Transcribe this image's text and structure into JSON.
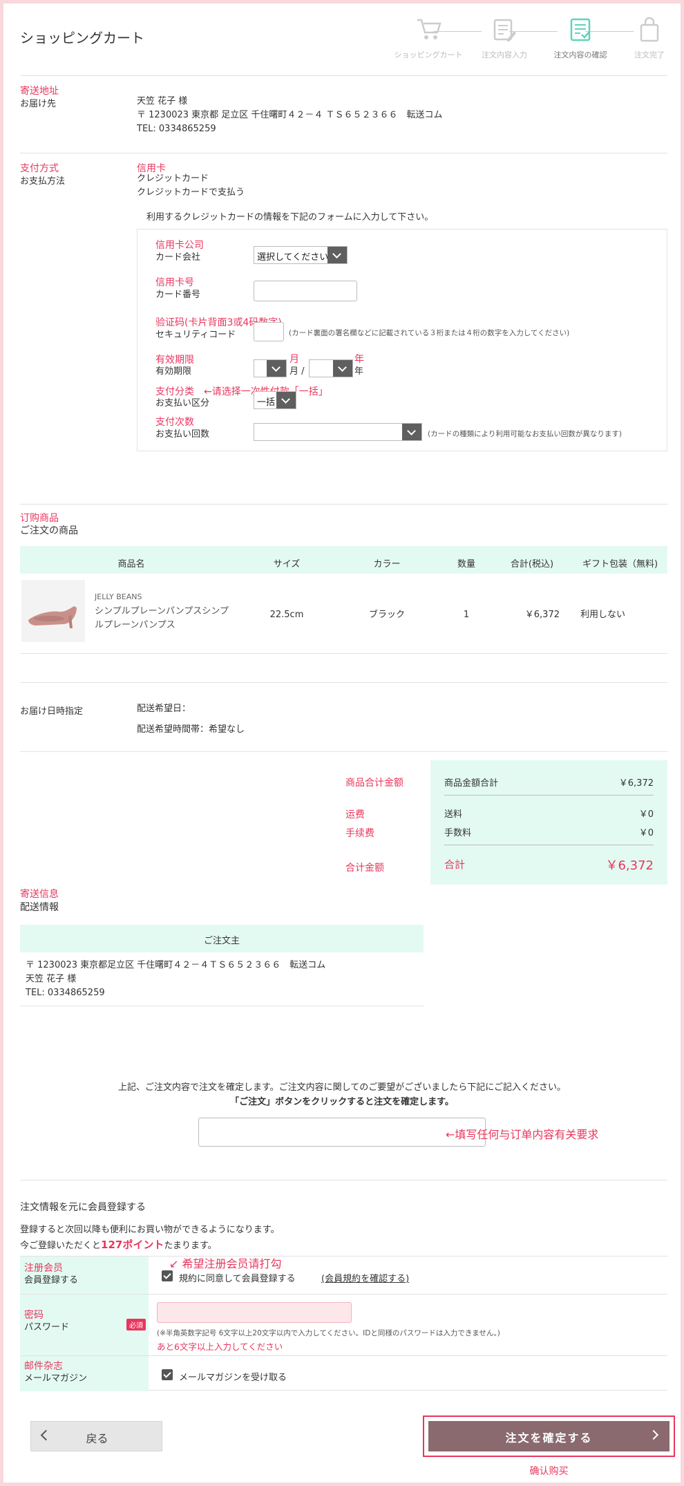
{
  "header": {
    "title": "ショッピングカート",
    "steps": [
      {
        "label": "ショッピングカート",
        "icon": "cart-icon"
      },
      {
        "label": "注文内容入力",
        "icon": "edit-form-icon"
      },
      {
        "label": "注文内容の確認",
        "icon": "checklist-icon"
      },
      {
        "label": "注文完了",
        "icon": "shopping-bag-icon"
      }
    ]
  },
  "shipping": {
    "zh": "寄送地址",
    "label": "お届け先",
    "name": "天笠 花子 様",
    "address": "〒 1230023 東京都 足立区 千住曙町４２－４ ＴＳ６５２３６６　転送コム",
    "tel": "TEL: 0334865259"
  },
  "payment": {
    "zh": "支付方式",
    "label": "お支払方法",
    "zh_method": "信用卡",
    "method": "クレジットカード",
    "method_sub": "クレジットカードで支払う",
    "instruction": "利用するクレジットカードの情報を下記のフォームに入力して下さい。",
    "card_company_zh": "信用卡公司",
    "card_company_label": "カード会社",
    "card_company_value": "選択してください",
    "card_number_zh": "信用卡号",
    "card_number_label": "カード番号",
    "security_zh": "验证码(卡片背面3或4码数字)",
    "security_label": "セキュリティコード",
    "security_note": "(カード裏面の署名欄などに記載されている３桁または４桁の数字を入力してください)",
    "expiry_zh": "有效期限",
    "expiry_label": "有効期限",
    "month_zh": "月",
    "year_zh": "年",
    "month_label": "月 /",
    "year_label": "年",
    "pay_type_zh": "支付分类",
    "pay_type_hint": "←请选择一次性付款「一括」",
    "pay_type_label": "お支払い区分",
    "pay_type_value": "一括",
    "installments_zh": "支付次数",
    "installments_label": "お支払い回数",
    "installments_note": "(カードの種類により利用可能なお支払い回数が異なります)"
  },
  "order": {
    "zh": "订购商品",
    "title": "ご注文の商品",
    "columns": [
      "商品名",
      "サイズ",
      "カラー",
      "数量",
      "合計(税込)",
      "ギフト包装（無料)"
    ],
    "item": {
      "brand": "JELLY BEANS",
      "name": "シンプルプレーンパンプスシンプルプレーンパンプス",
      "size": "22.5cm",
      "color": "ブラック",
      "qty": "1",
      "total": "￥6,372",
      "gift": "利用しない"
    }
  },
  "delivery_date": {
    "label": "お届け日時指定",
    "date": "配送希望日：",
    "time": "配送希望時間帯：希望なし"
  },
  "totals": {
    "subtotal_zh": "商品合计金额",
    "shipping_zh": "运费",
    "fee_zh": "手续费",
    "total_zh": "合计金额",
    "subtotal_label": "商品金額合計",
    "subtotal_value": "￥6,372",
    "shipping_label": "送料",
    "shipping_value": "￥0",
    "fee_label": "手数料",
    "fee_value": "￥0",
    "total_label": "合計",
    "total_value": "￥6,372"
  },
  "delivery_info": {
    "zh": "寄送信息",
    "title": "配送情報",
    "header": "ご注文主",
    "address": "〒 1230023 東京都足立区 千住曙町４２－４ＴＳ６５２３６６　転送コム",
    "name": "天笠 花子 様",
    "tel": "TEL: 0334865259"
  },
  "confirm": {
    "line1": "上記、ご注文内容で注文を確定します。ご注文内容に関してのご要望がございましたら下記にご記入ください。",
    "line2": "「ご注文」ボタンをクリックすると注文を確定します。",
    "comment_hint": "←填写任何与订单内容有关要求"
  },
  "member": {
    "title": "注文情報を元に会員登録する",
    "line1": "登録すると次回以降も便利にお買い物ができるようになります。",
    "line2_pre": "今ご登録いただくと",
    "line2_points": "127ポイント",
    "line2_post": "たまります。",
    "register_hint": "↙ 希望注册会员请打勾",
    "register_zh": "注册会员",
    "register_label": "会員登録する",
    "register_check": "規約に同意して会員登録する",
    "terms_link": "(会員規約を確認する)",
    "password_zh": "密码",
    "password_label": "パスワード",
    "required": "必須",
    "password_note": "(※半角英数字記号 6文字以上20文字以内で入力してください。IDと同様のパスワードは入力できません。)",
    "password_error": "あと6文字以上入力してください",
    "magazine_zh": "邮件杂志",
    "magazine_label": "メールマガジン",
    "magazine_check": "メールマガジンを受け取る"
  },
  "footer": {
    "back": "戻る",
    "confirm": "注文を確定する",
    "confirm_zh": "确认购买"
  },
  "colors": {
    "accent": "#e8365d",
    "mint": "#e3faf2",
    "button": "#8a6a6f",
    "frame": "#f8d7dd"
  }
}
